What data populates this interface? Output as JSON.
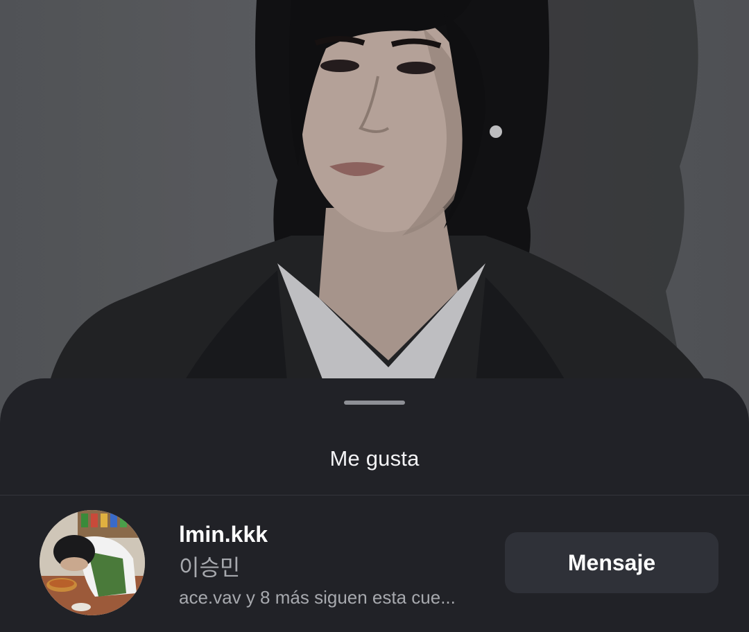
{
  "background_photo": {
    "description_icon": "portrait-photo"
  },
  "sheet": {
    "title": "Me gusta"
  },
  "user": {
    "username": "lmin.kkk",
    "full_name": "이승민",
    "followers_text": "ace.vav y 8 más siguen esta cue...",
    "avatar_icon": "profile-avatar"
  },
  "actions": {
    "message_label": "Mensaje"
  },
  "colors": {
    "sheet_bg": "#212227",
    "button_bg": "#2f3138",
    "primary_text": "#ffffff",
    "secondary_text": "#a7a9ae"
  }
}
